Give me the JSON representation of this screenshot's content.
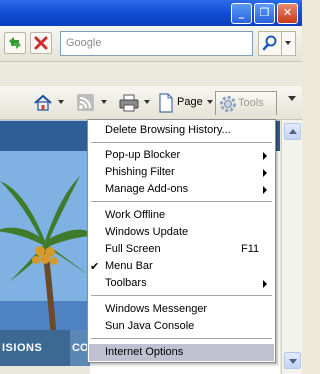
{
  "search": {
    "placeholder": "Google"
  },
  "command_bar": {
    "page_label": "Page",
    "tools_label": "Tools"
  },
  "content": {
    "nav_tab_1": "ISIONS",
    "nav_tab_2": "CO"
  },
  "tools_menu": {
    "items": [
      {
        "label": "Delete Browsing History..."
      },
      {
        "label": "Pop-up Blocker"
      },
      {
        "label": "Phishing Filter"
      },
      {
        "label": "Manage Add-ons"
      },
      {
        "label": "Work Offline"
      },
      {
        "label": "Windows Update"
      },
      {
        "label": "Full Screen",
        "shortcut": "F11"
      },
      {
        "label": "Menu Bar",
        "check": "✔"
      },
      {
        "label": "Toolbars"
      },
      {
        "label": "Windows Messenger"
      },
      {
        "label": "Sun Java Console"
      },
      {
        "label": "Internet Options"
      }
    ]
  },
  "colors": {
    "menu_highlight": "#c1c0d0",
    "title_bar": "#0f4bd2",
    "content_band": "#2f5d95"
  }
}
